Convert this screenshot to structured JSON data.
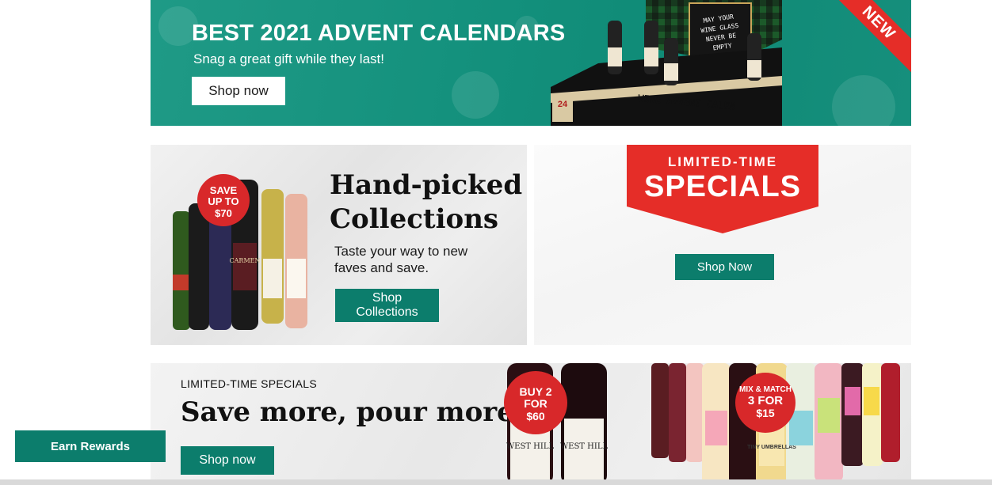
{
  "hero": {
    "title": "BEST 2021 ADVENT CALENDARS",
    "subtitle": "Snag a great gift while they last!",
    "button_label": "Shop now",
    "ribbon": "NEW",
    "box_label": "WINE ADVENT CALEN",
    "box_number": "24",
    "box_card": [
      "MAY YOUR",
      "WINE GLASS",
      "NEVER BE",
      "EMPTY"
    ],
    "accent_color": "#13907c",
    "ribbon_color": "#e52d28"
  },
  "collections": {
    "title_line1": "Hand-picked",
    "title_line2": "Collections",
    "subtitle_line1": "Taste your way to new",
    "subtitle_line2": "faves and save.",
    "button_label": "Shop Collections",
    "badge": [
      "SAVE",
      "UP TO",
      "$70"
    ],
    "bottle_label": "CARMEN"
  },
  "specials": {
    "line1": "LIMITED-TIME",
    "line2": "SPECIALS",
    "button_label": "Shop Now",
    "badge_color": "#e52d28"
  },
  "save_banner": {
    "kicker": "LIMITED-TIME SPECIALS",
    "title": "Save more, pour more",
    "button_label": "Shop now",
    "badge1": [
      "BUY 2",
      "FOR",
      "$60"
    ],
    "badge2": [
      "MIX & MATCH",
      "3 FOR",
      "$15"
    ],
    "bottle_label1": "WEST HILL",
    "bottle_label2": "TINY UMBRELLAS"
  },
  "rewards": {
    "button_label": "Earn Rewards"
  },
  "colors": {
    "brand_green": "#0c7d6c",
    "promo_red": "#e52d28"
  }
}
